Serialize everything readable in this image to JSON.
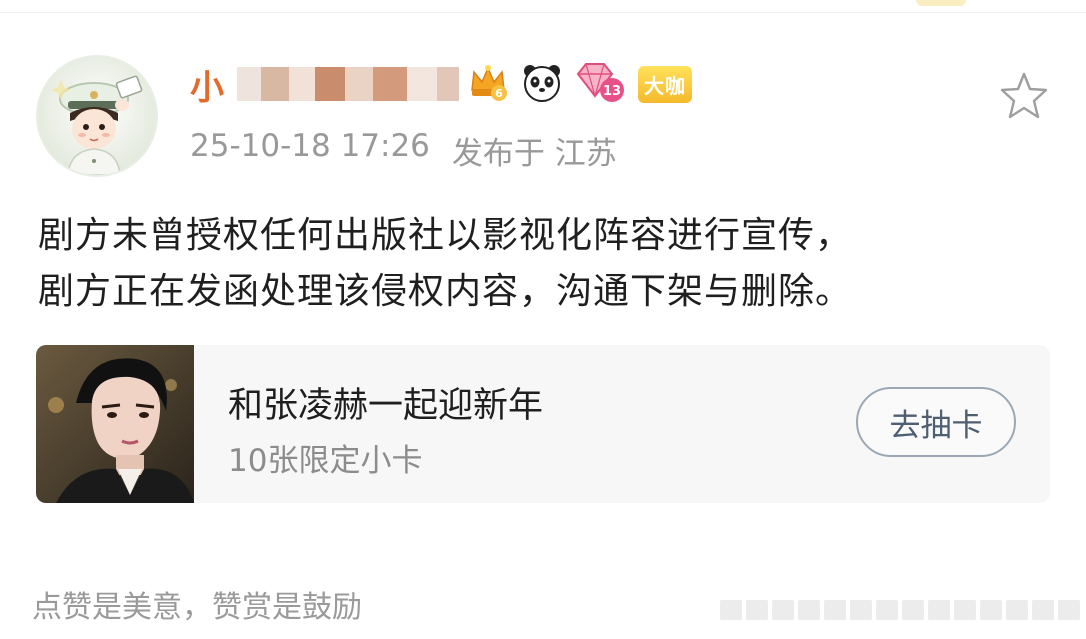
{
  "post": {
    "username_visible": "小",
    "timestamp": "25-10-18 17:26",
    "location": "发布于 江苏",
    "body_lines": [
      "剧方未曾授权任何出版社以影视化阵容进行宣传，",
      "剧方正在发函处理该侵权内容，沟通下架与删除。"
    ]
  },
  "badges": {
    "crown_level": "6",
    "diamond_level": "13",
    "daka_label": "大咖"
  },
  "card": {
    "title": "和张凌赫一起迎新年",
    "subtitle": "10张限定小卡",
    "button_label": "去抽卡"
  },
  "footer": {
    "reward_text": "点赞是美意，赞赏是鼓励"
  },
  "colors": {
    "username": "#e26a2c",
    "meta": "#999999",
    "card_bg": "#f7f7f7",
    "button_border": "#9aa8b6"
  },
  "icons": [
    "avatar",
    "crown-badge-icon",
    "panda-badge-icon",
    "diamond-badge-icon",
    "star-icon"
  ]
}
